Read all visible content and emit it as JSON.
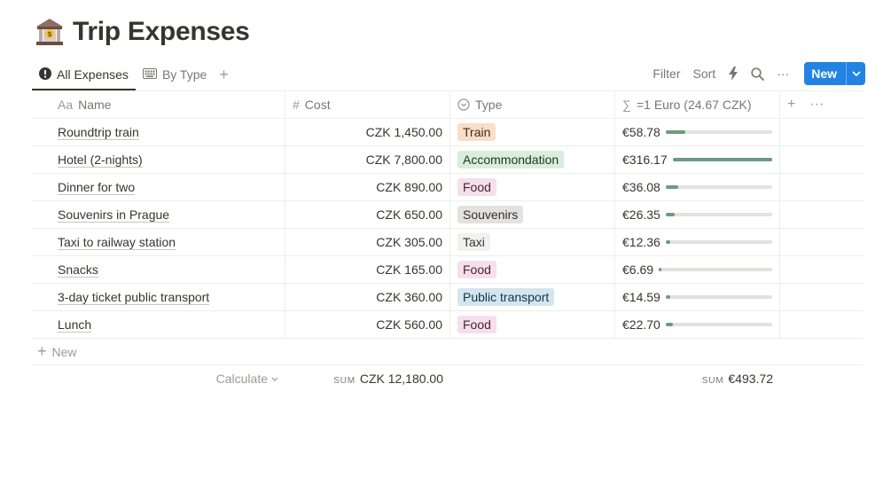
{
  "page": {
    "title": "Trip Expenses",
    "icon": "bank-building-icon"
  },
  "views": {
    "tabs": [
      {
        "label": "All Expenses",
        "icon": "alert-circle-icon",
        "active": true
      },
      {
        "label": "By Type",
        "icon": "keyboard-icon",
        "active": false
      }
    ],
    "add_symbol": "+"
  },
  "toolbar": {
    "filter_label": "Filter",
    "sort_label": "Sort",
    "automation_icon": "lightning-icon",
    "search_icon": "search-icon",
    "more_symbol": "···",
    "new_label": "New"
  },
  "table": {
    "columns": {
      "name": {
        "label": "Name",
        "prefix": "Aa"
      },
      "cost": {
        "label": "Cost",
        "prefix": "#"
      },
      "type": {
        "label": "Type"
      },
      "euro": {
        "label": "=1 Euro (24.67 CZK)",
        "prefix": "∑"
      },
      "add": "+",
      "more": "···"
    },
    "rows": [
      {
        "name": "Roundtrip train",
        "cost": "CZK 1,450.00",
        "type": "Train",
        "euro": "€58.78"
      },
      {
        "name": "Hotel (2-nights)",
        "cost": "CZK 7,800.00",
        "type": "Accommondation",
        "euro": "€316.17"
      },
      {
        "name": "Dinner for two",
        "cost": "CZK 890.00",
        "type": "Food",
        "euro": "€36.08"
      },
      {
        "name": "Souvenirs in Prague",
        "cost": "CZK 650.00",
        "type": "Souvenirs",
        "euro": "€26.35"
      },
      {
        "name": "Taxi to railway station",
        "cost": "CZK 305.00",
        "type": "Taxi",
        "euro": "€12.36"
      },
      {
        "name": "Snacks",
        "cost": "CZK 165.00",
        "type": "Food",
        "euro": "€6.69"
      },
      {
        "name": "3-day ticket public transport",
        "cost": "CZK 360.00",
        "type": "Public transport",
        "euro": "€14.59"
      },
      {
        "name": "Lunch",
        "cost": "CZK 560.00",
        "type": "Food",
        "euro": "€22.70"
      }
    ],
    "bar_values": [
      0.186,
      1.0,
      0.114,
      0.083,
      0.039,
      0.021,
      0.046,
      0.072
    ],
    "tag_colors": {
      "Train": {
        "bg": "#fadec9",
        "fg": "#49290e"
      },
      "Accommondation": {
        "bg": "#dbeddb",
        "fg": "#1c3829"
      },
      "Food": {
        "bg": "#f5e0e9",
        "fg": "#4c2337"
      },
      "Souvenirs": {
        "bg": "#e3e2e0",
        "fg": "#32302c"
      },
      "Taxi": {
        "bg": "#f1f1ef",
        "fg": "#37352f"
      },
      "Public transport": {
        "bg": "#d3e5ef",
        "fg": "#183347"
      }
    },
    "bar_color": "#6b9c7f",
    "new_row_label": "New",
    "footer": {
      "calculate_label": "Calculate",
      "cost_sum_label": "SUM",
      "cost_sum_value": "CZK 12,180.00",
      "euro_sum_label": "SUM",
      "euro_sum_value": "€493.72"
    }
  },
  "accent_color": "#2383e2"
}
